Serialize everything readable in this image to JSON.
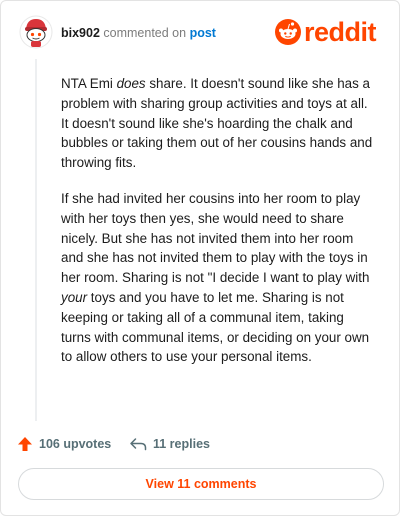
{
  "header": {
    "username": "bix902",
    "commented_text": "commented on",
    "post_link": "post",
    "logo_text": "reddit"
  },
  "comment": {
    "p1_a": "NTA Emi ",
    "p1_em": "does",
    "p1_b": " share. It doesn't sound like she has a problem with sharing group activities and toys at all. It doesn't sound like she's hoarding the chalk and bubbles or taking them out of her cousins hands and throwing fits.",
    "p2_a": "If she had invited her cousins into her room to play with her toys then yes, she would need to share nicely. But she has not invited them into her room and she has not invited them to play with the toys in her room. Sharing is not \"I decide I want to play with ",
    "p2_em": "your",
    "p2_b": " toys and you have to let me. Sharing is not keeping or taking all of a communal item, taking turns with communal items, or deciding on your own to allow others to use your personal items."
  },
  "actions": {
    "upvotes": "106 upvotes",
    "replies": "11 replies"
  },
  "view_button": "View 11 comments",
  "colors": {
    "brand": "#ff4500",
    "link": "#0079d3",
    "meta": "#576f76"
  }
}
